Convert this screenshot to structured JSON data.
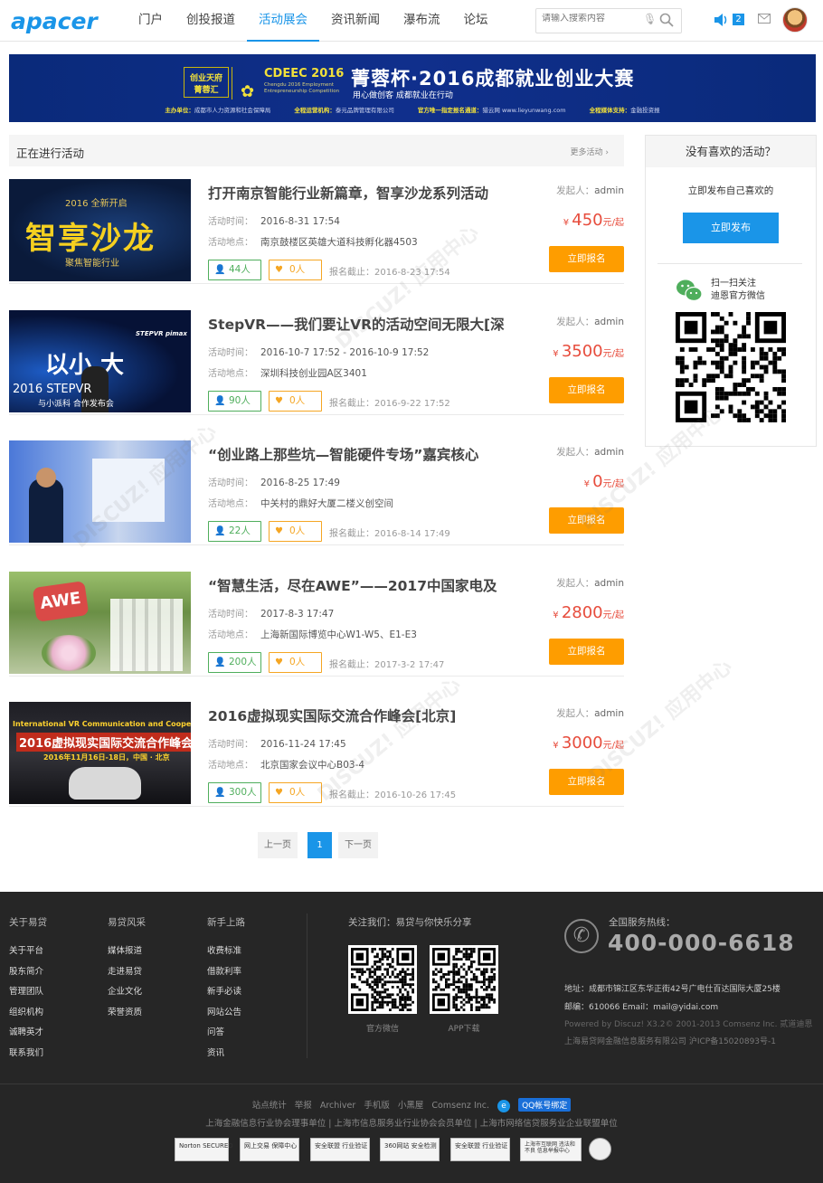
{
  "header": {
    "logo": "apacer",
    "nav": [
      "门户",
      "创投报道",
      "活动展会",
      "资讯新闻",
      "瀑布流",
      "论坛"
    ],
    "active_nav": "活动展会",
    "search_placeholder": "请输入搜索内容",
    "notification_count": "2",
    "icons": [
      "mic-icon",
      "search-icon",
      "speaker-icon",
      "mail-icon",
      "avatar"
    ]
  },
  "banner": {
    "logo_text": "创业天府 菁蓉汇",
    "cdeec": "CDEEC 2016",
    "cdeec_sub": "Chengdu 2016 Employment Entrepreneurship Competition",
    "title": "菁蓉杯·2016成都就业创业大赛",
    "subtitle": "用心做创客  成都就业在行动",
    "footer": [
      {
        "k": "主办单位：",
        "v": "成都市人力资源和社会保障局"
      },
      {
        "k": "全程运营机构：",
        "v": "泰元品牌管理有限公司"
      },
      {
        "k": "官方唯一指定报名通道：",
        "v": "猎云网 www.lieyunwang.com"
      },
      {
        "k": "全程媒体支持：",
        "v": "金融投资报"
      }
    ]
  },
  "list": {
    "heading": "正在进行活动",
    "more": "更多活动 ›",
    "time_label": "活动时间：",
    "place_label": "活动地点：",
    "initiator_label": "发起人：",
    "currency": "¥",
    "price_unit": "元/起",
    "signup_label": "立即报名",
    "deadline_label": "报名截止：",
    "items": [
      {
        "title": "打开南京智能行业新篇章，智享沙龙系列活动",
        "time": "2016-8-31 17:54",
        "place": "南京鼓楼区英雄大道科技孵化器4503",
        "initiator": "admin",
        "price": "450",
        "joined": "44人",
        "likes": "0人",
        "deadline": "2016-8-23 17:54"
      },
      {
        "title": "StepVR——我们要让VR的活动空间无限大[深",
        "time": "2016-10-7 17:52 - 2016-10-9 17:52",
        "place": "深圳科技创业园A区3401",
        "initiator": "admin",
        "price": "3500",
        "joined": "90人",
        "likes": "0人",
        "deadline": "2016-9-22 17:52"
      },
      {
        "title": "“创业路上那些坑—智能硬件专场”嘉宾核心",
        "time": "2016-8-25 17:49",
        "place": "中关村的鼎好大厦二楼义创空间",
        "initiator": "admin",
        "price": "0",
        "joined": "22人",
        "likes": "0人",
        "deadline": "2016-8-14 17:49"
      },
      {
        "title": "“智慧生活，尽在AWE”——2017中国家电及",
        "time": "2017-8-3 17:47",
        "place": "上海新国际博览中心W1-W5、E1-E3",
        "initiator": "admin",
        "price": "2800",
        "joined": "200人",
        "likes": "0人",
        "deadline": "2017-3-2 17:47"
      },
      {
        "title": "2016虚拟现实国际交流合作峰会[北京]",
        "time": "2016-11-24 17:45",
        "place": "北京国家会议中心B03-4",
        "initiator": "admin",
        "price": "3000",
        "joined": "300人",
        "likes": "0人",
        "deadline": "2016-10-26 17:45"
      }
    ],
    "thumbs": {
      "t1_big": "智享沙龙",
      "t1_top": "2016 全新开启",
      "t1_bot": "聚焦智能行业",
      "t2_big": "以小 大",
      "t2_sub1": "2016 STEPVR",
      "t2_sub2": "与小派科  合作发布会",
      "t2_logo": "STEPVR  pimax",
      "t4_sign": "AWE",
      "t5_l1": "International VR Communication and Cooperation Summit 2016",
      "t5_l2": "2016虚拟现实国际交流合作峰会",
      "t5_l3": "2016年11月16日-18日，中国 · 北京"
    }
  },
  "pager": {
    "prev": "上一页",
    "current": "1",
    "next": "下一页"
  },
  "sidebar": {
    "heading": "没有喜欢的活动？",
    "text": "立即发布自己喜欢的",
    "publish": "立即发布",
    "wechat_line1": "扫一扫关注",
    "wechat_line2": "迪恩官方微信"
  },
  "footer": {
    "cols": [
      {
        "heading": "关于易贷",
        "items": [
          "关于平台",
          "股东简介",
          "管理团队",
          "组织机构",
          "诚聘英才",
          "联系我们"
        ]
      },
      {
        "heading": "易贷风采",
        "items": [
          "媒体报道",
          "走进易贷",
          "企业文化",
          "荣誉资质"
        ]
      },
      {
        "heading": "新手上路",
        "items": [
          "收费标准",
          "借款利率",
          "新手必读",
          "网站公告",
          "问答",
          "资讯"
        ]
      }
    ],
    "follow": "关注我们：易贷与你快乐分享",
    "qr_labels": [
      "官方微信",
      "APP下载"
    ],
    "hotline_label": "全国服务热线：",
    "hotline": "400-000-6618",
    "address": "地址：成都市锦江区东华正街42号广电仕百达国际大厦25楼",
    "postal": "邮编：610066 Email：mail@yidai.com",
    "powered": "Powered by Discuz! X3.2© 2001-2013 Comsenz Inc.  贰道迪恩",
    "company": "上海易贷网金融信息服务有限公司  沪ICP备15020893号-1",
    "links": [
      "站点统计",
      "举报",
      "Archiver",
      "手机版",
      "小黑屋",
      "Comsenz Inc."
    ],
    "qq_bind": "QQ帐号绑定",
    "assoc": "上海金融信息行业协会理事单位 | 上海市信息服务业行业协会会员单位 | 上海市网络信贷服务业企业联盟单位",
    "badges": [
      "Norton SECURED",
      "网上交易 保障中心",
      "安全联盟 行业验证",
      "360网站 安全检测",
      "安全联盟 行业验证",
      "上海市互联网 违法和不良 信息举报中心"
    ]
  },
  "colors": {
    "brand_blue": "#1a95e8",
    "signup_orange": "#fe9d00",
    "price_red": "#e74c3c",
    "green": "#4fae5c",
    "footer_bg": "#262626"
  }
}
